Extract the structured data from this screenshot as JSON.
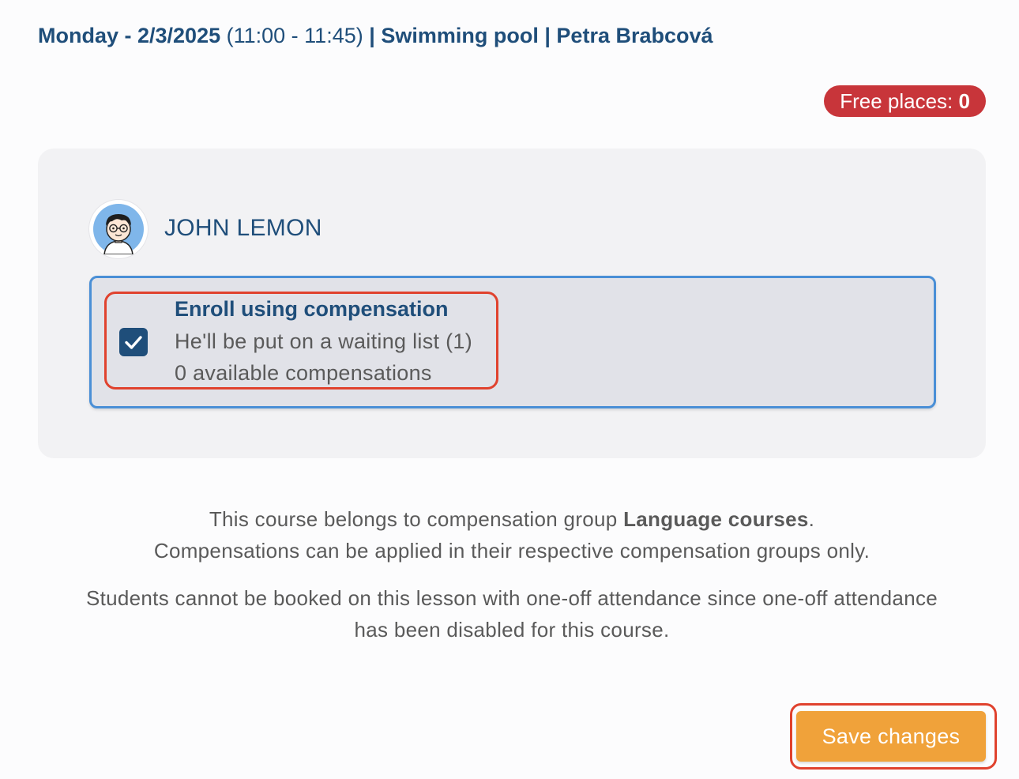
{
  "lesson": {
    "date_label": "Monday - 2/3/2025",
    "time_range": "(11:00 - 11:45)",
    "separator": "|",
    "location": "Swimming pool",
    "instructor": "Petra Brabcová"
  },
  "capacity": {
    "label": "Free places:",
    "value": "0",
    "color": "#c8353a"
  },
  "student": {
    "name": "JOHN LEMON",
    "avatar_icon": "boy-with-glasses-avatar"
  },
  "enroll_option": {
    "checked": true,
    "title": "Enroll using compensation",
    "waiting_list_text": "He'll be put on a waiting list (1)",
    "available_text": "0 available compensations"
  },
  "info": {
    "group_prefix": "This course belongs to compensation group ",
    "group_name": "Language courses",
    "group_suffix": ".",
    "group_note": "Compensations can be applied in their respective compensation groups only.",
    "one_off_line1": "Students cannot be booked on this lesson with one-off attendance since one-off attendance",
    "one_off_line2": "has been disabled for this course."
  },
  "actions": {
    "save_label": "Save changes",
    "save_color": "#f0a23a"
  },
  "colors": {
    "primary": "#1f4e7a",
    "highlight": "#e0422e",
    "option_border": "#4a8fd6"
  }
}
